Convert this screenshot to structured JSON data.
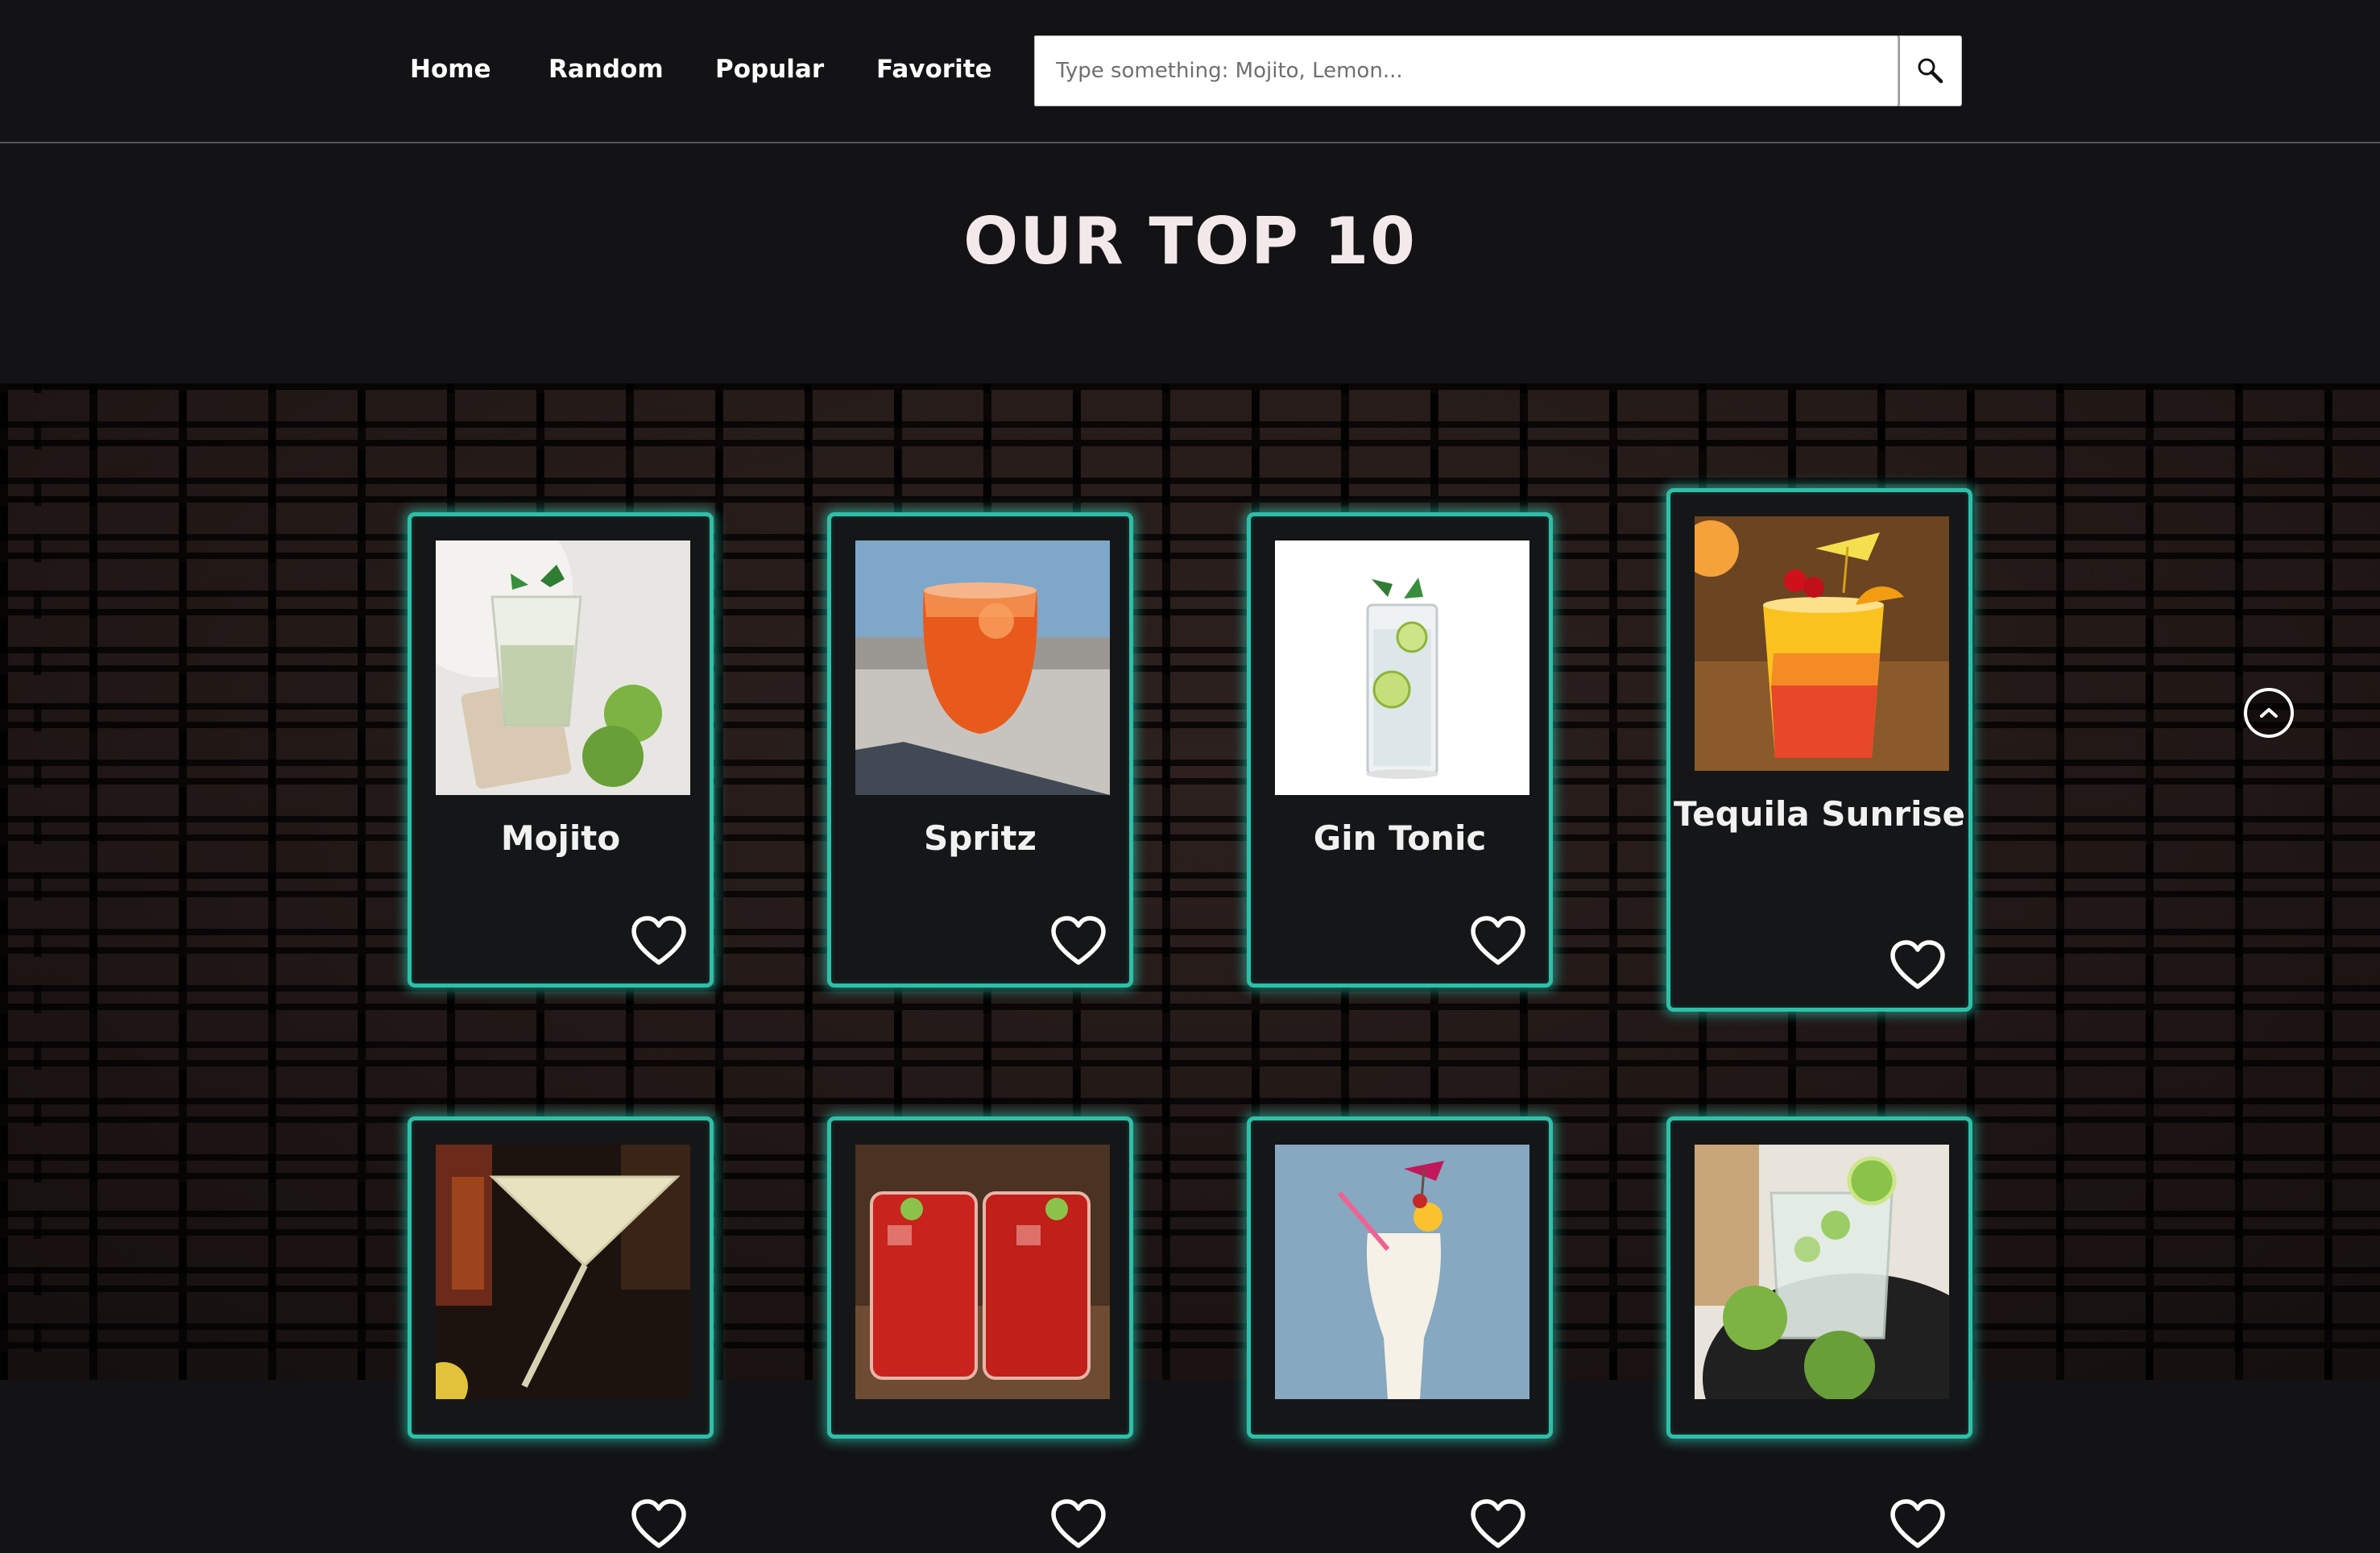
{
  "nav": {
    "items": [
      {
        "label": "Home"
      },
      {
        "label": "Random"
      },
      {
        "label": "Popular"
      },
      {
        "label": "Favorite"
      }
    ]
  },
  "search": {
    "placeholder": "Type something: Mojito, Lemon...",
    "value": "",
    "button_icon": "search-icon"
  },
  "page": {
    "title": "OUR TOP 10"
  },
  "cards": [
    {
      "name": "Mojito",
      "image": "mojito-photo",
      "favorite_icon": "heart-outline-icon"
    },
    {
      "name": "Spritz",
      "image": "spritz-photo",
      "favorite_icon": "heart-outline-icon"
    },
    {
      "name": "Gin Tonic",
      "image": "gin-tonic-photo",
      "favorite_icon": "heart-outline-icon"
    },
    {
      "name": "Tequila Sunrise",
      "image": "tequila-sunrise-photo",
      "favorite_icon": "heart-outline-icon"
    },
    {
      "name": "",
      "image": "martini-photo",
      "favorite_icon": "heart-outline-icon"
    },
    {
      "name": "",
      "image": "bloody-mary-photo",
      "favorite_icon": "heart-outline-icon"
    },
    {
      "name": "",
      "image": "pina-colada-photo",
      "favorite_icon": "heart-outline-icon"
    },
    {
      "name": "",
      "image": "lime-highball-photo",
      "favorite_icon": "heart-outline-icon"
    }
  ],
  "scroll_top": {
    "icon": "chevron-up-circle-icon"
  },
  "colors": {
    "background": "#131315",
    "card_border": "#2fbfa8",
    "card_glow": "#2fd5bc",
    "title": "#f3e9ea"
  }
}
